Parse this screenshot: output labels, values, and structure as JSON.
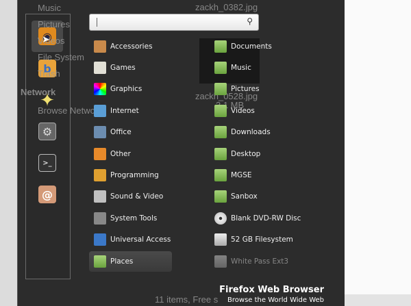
{
  "background_file_manager": {
    "sidebar": [
      "Music",
      "Pictures",
      "Videos",
      "File System",
      "Trash"
    ],
    "network_heading": "Network",
    "network_items": [
      "Browse Network"
    ],
    "files": [
      "zackh_0382.jpg",
      "zackh_0528.jpg"
    ],
    "file_size": "3.1 MB",
    "status": "11 items, Free s"
  },
  "search": {
    "placeholder": "",
    "icon": "search-icon"
  },
  "favorites": [
    {
      "name": "firefox",
      "icon": "firefox-icon",
      "color": "#e08a1e"
    },
    {
      "name": "banshee",
      "icon": "banshee-icon",
      "color": "#e9a33a"
    },
    {
      "name": "pidgin",
      "icon": "star-icon",
      "color": "#f0e070"
    },
    {
      "name": "system-monitor",
      "icon": "settings-icon",
      "color": "#666666"
    },
    {
      "name": "terminal",
      "icon": "terminal-icon",
      "color": "#333333"
    },
    {
      "name": "ubuntu-one",
      "icon": "ubuntu-one-icon",
      "color": "#d49a78"
    }
  ],
  "categories": [
    {
      "label": "Accessories",
      "color": "#c98a4b"
    },
    {
      "label": "Games",
      "color": "#e2e0d6"
    },
    {
      "label": "Graphics",
      "color": "#c0409a"
    },
    {
      "label": "Internet",
      "color": "#5a9ed6"
    },
    {
      "label": "Office",
      "color": "#6c8db0"
    },
    {
      "label": "Other",
      "color": "#e88a2a"
    },
    {
      "label": "Programming",
      "color": "#e0a030"
    },
    {
      "label": "Sound & Video",
      "color": "#c0c0c0"
    },
    {
      "label": "System Tools",
      "color": "#888888"
    },
    {
      "label": "Universal Access",
      "color": "#3b78c8"
    },
    {
      "label": "Places",
      "color": "#8cc060"
    }
  ],
  "places": [
    {
      "label": "Documents",
      "type": "folder"
    },
    {
      "label": "Music",
      "type": "folder"
    },
    {
      "label": "Pictures",
      "type": "folder"
    },
    {
      "label": "Videos",
      "type": "folder"
    },
    {
      "label": "Downloads",
      "type": "folder"
    },
    {
      "label": "Desktop",
      "type": "folder"
    },
    {
      "label": "MGSE",
      "type": "folder"
    },
    {
      "label": "Sanbox",
      "type": "folder"
    },
    {
      "label": "Blank DVD-RW Disc",
      "type": "disc"
    },
    {
      "label": "52 GB Filesystem",
      "type": "drive"
    },
    {
      "label": "White Pass Ext3",
      "type": "drive-unmounted"
    }
  ],
  "description": {
    "title": "Firefox Web Browser",
    "subtitle": "Browse the World Wide Web"
  }
}
